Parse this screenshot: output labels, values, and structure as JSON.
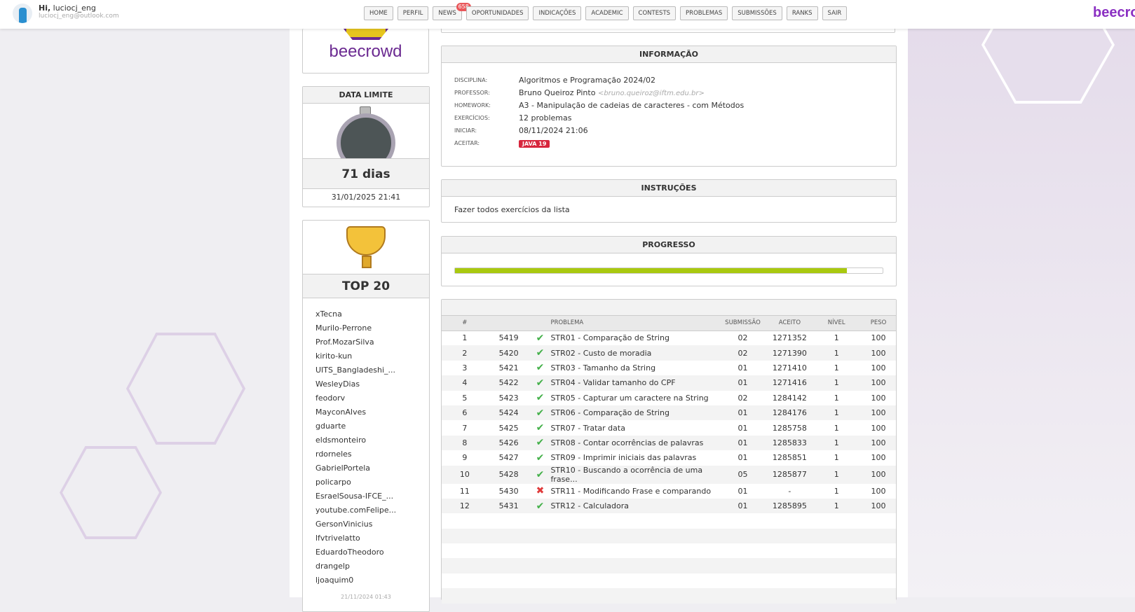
{
  "user": {
    "greeting": "Hi,",
    "name": "luciocj_eng",
    "email": "luciocj_eng@outlook.com"
  },
  "nav": [
    {
      "label": "HOME"
    },
    {
      "label": "PERFIL"
    },
    {
      "label": "NEWS",
      "badge": "658"
    },
    {
      "label": "OPORTUNIDADES"
    },
    {
      "label": "INDICAÇÕES"
    },
    {
      "label": "ACADEMIC"
    },
    {
      "label": "CONTESTS"
    },
    {
      "label": "PROBLEMAS"
    },
    {
      "label": "SUBMISSÕES"
    },
    {
      "label": "RANKS"
    },
    {
      "label": "SAIR"
    }
  ],
  "brand": "beecrowd",
  "logo_text": "beecrowd",
  "deadline": {
    "title": "DATA LIMITE",
    "days": "71 dias",
    "date": "31/01/2025 21:41"
  },
  "top20": {
    "title": "TOP 20",
    "users": [
      "xTecna",
      "Murilo-Perrone",
      "Prof.MozarSilva",
      "kirito-kun",
      "UITS_Bangladeshi_...",
      "WesleyDias",
      "feodorv",
      "MayconAlves",
      "gduarte",
      "eldsmonteiro",
      "rdorneles",
      "GabrielPortela",
      "policarpo",
      "EsraelSousa-IFCE_...",
      "youtube.comFelipe...",
      "GersonVinicius",
      "lfvtrivelatto",
      "EduardoTheodoro",
      "drangelp",
      "ljoaquim0"
    ],
    "updated": "21/11/2024 01:43"
  },
  "info": {
    "title": "INFORMAÇÃO",
    "rows": [
      {
        "k": "DISCIPLINA:",
        "v": "Algoritmos e Programação 2024/02"
      },
      {
        "k": "PROFESSOR:",
        "v": "Bruno Queiroz Pinto",
        "extra": "<bruno.queiroz@iftm.edu.br>"
      },
      {
        "k": "HOMEWORK:",
        "v": "A3 - Manipulação de cadeias de caracteres - com Métodos"
      },
      {
        "k": "EXERCÍCIOS:",
        "v": "12 problemas"
      },
      {
        "k": "INICIAR:",
        "v": "08/11/2024 21:06"
      },
      {
        "k": "ACEITAR:",
        "badge": "JAVA 19"
      }
    ]
  },
  "instructions": {
    "title": "INSTRUÇÕES",
    "text": "Fazer todos exercícios da lista"
  },
  "progress": {
    "title": "PROGRESSO",
    "percent": 91.7
  },
  "table": {
    "headers": [
      "#",
      "",
      "",
      "PROBLEMA",
      "SUBMISSÃO",
      "ACEITO",
      "NÍVEL",
      "PESO"
    ],
    "rows": [
      [
        "1",
        "5419",
        "ok",
        "STR01 - Comparação de String",
        "02",
        "1271352",
        "1",
        "100"
      ],
      [
        "2",
        "5420",
        "ok",
        "STR02 - Custo de moradia",
        "02",
        "1271390",
        "1",
        "100"
      ],
      [
        "3",
        "5421",
        "ok",
        "STR03 - Tamanho da String",
        "01",
        "1271410",
        "1",
        "100"
      ],
      [
        "4",
        "5422",
        "ok",
        "STR04 - Validar tamanho do CPF",
        "01",
        "1271416",
        "1",
        "100"
      ],
      [
        "5",
        "5423",
        "ok",
        "STR05 - Capturar um caractere na String",
        "02",
        "1284142",
        "1",
        "100"
      ],
      [
        "6",
        "5424",
        "ok",
        "STR06 - Comparação de String",
        "01",
        "1284176",
        "1",
        "100"
      ],
      [
        "7",
        "5425",
        "ok",
        "STR07 - Tratar data",
        "01",
        "1285758",
        "1",
        "100"
      ],
      [
        "8",
        "5426",
        "ok",
        "STR08 - Contar ocorrências de palavras",
        "01",
        "1285833",
        "1",
        "100"
      ],
      [
        "9",
        "5427",
        "ok",
        "STR09 - Imprimir iniciais das palavras",
        "01",
        "1285851",
        "1",
        "100"
      ],
      [
        "10",
        "5428",
        "ok",
        "STR10 - Buscando a ocorrência de uma frase...",
        "05",
        "1285877",
        "1",
        "100"
      ],
      [
        "11",
        "5430",
        "no",
        "STR11 - Modificando Frase e comparando",
        "01",
        "-",
        "1",
        "100"
      ],
      [
        "12",
        "5431",
        "ok",
        "STR12 - Calculadora",
        "01",
        "1285895",
        "1",
        "100"
      ]
    ]
  }
}
